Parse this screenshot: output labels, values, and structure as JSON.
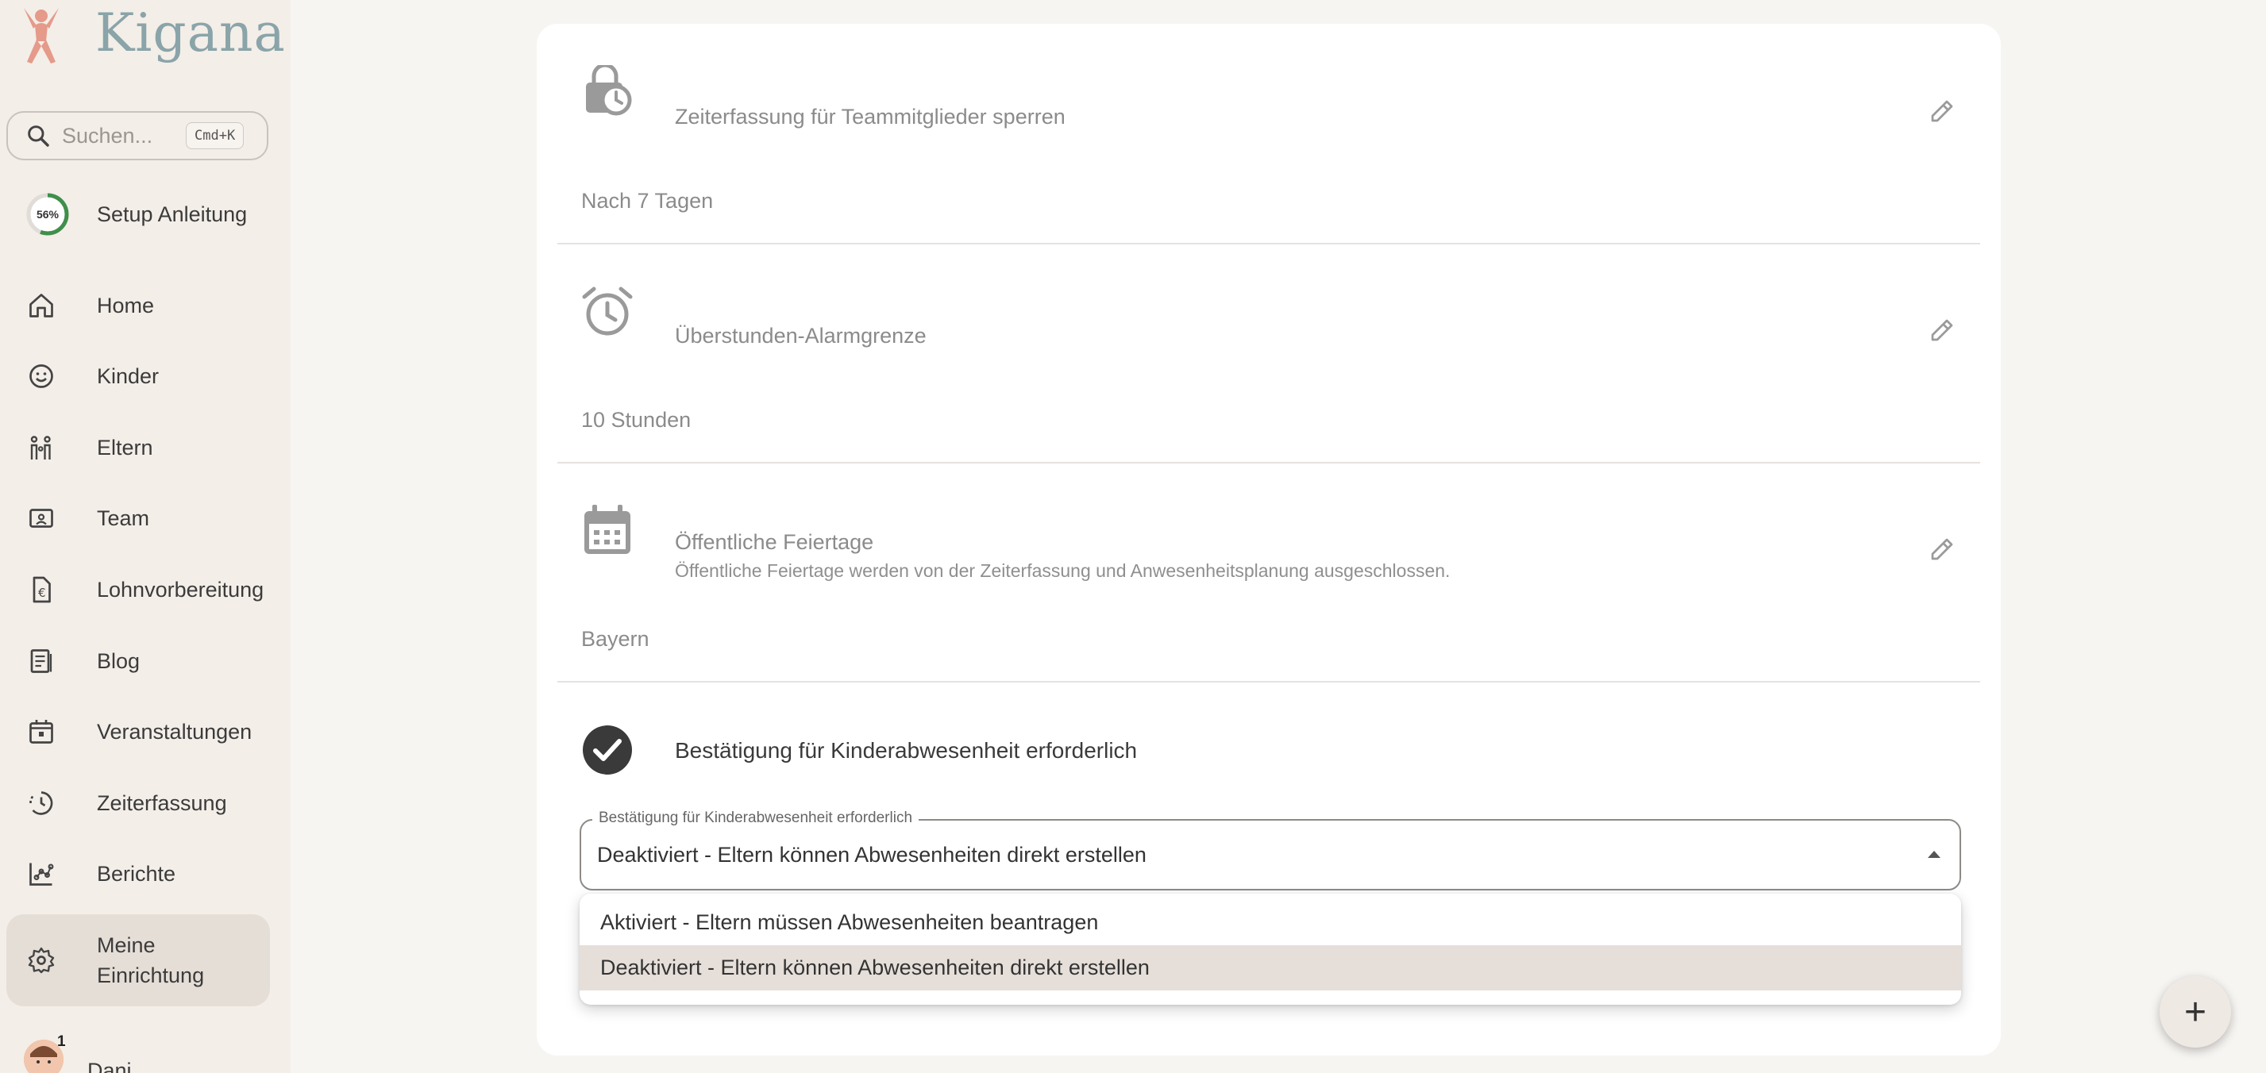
{
  "app": {
    "name": "Kigana"
  },
  "search": {
    "placeholder": "Suchen...",
    "shortcut": "Cmd+K"
  },
  "setup": {
    "label": "Setup Anleitung",
    "progress_text": "56%",
    "progress": 0.56
  },
  "nav": [
    {
      "id": "home",
      "label": "Home",
      "icon": "home-icon"
    },
    {
      "id": "kinder",
      "label": "Kinder",
      "icon": "smiley-icon"
    },
    {
      "id": "eltern",
      "label": "Eltern",
      "icon": "family-icon"
    },
    {
      "id": "team",
      "label": "Team",
      "icon": "badge-icon"
    },
    {
      "id": "lohn",
      "label": "Lohnvorbereitung",
      "icon": "euro-document-icon"
    },
    {
      "id": "blog",
      "label": "Blog",
      "icon": "article-icon"
    },
    {
      "id": "events",
      "label": "Veranstaltungen",
      "icon": "calendar-icon"
    },
    {
      "id": "time",
      "label": "Zeiterfassung",
      "icon": "clock-history-icon"
    },
    {
      "id": "reports",
      "label": "Berichte",
      "icon": "chart-icon"
    },
    {
      "id": "settings",
      "label": "Meine Einrichtung",
      "icon": "gear-icon",
      "active": true
    }
  ],
  "user": {
    "name": "Dani",
    "badge": "1"
  },
  "sections": [
    {
      "id": "lock",
      "title": "Zeiterfassung für Teammitglieder sperren",
      "value": "Nach 7 Tagen",
      "icon": "lock-clock-icon"
    },
    {
      "id": "overtime",
      "title": "Überstunden-Alarmgrenze",
      "value": "10 Stunden",
      "icon": "alarm-clock-icon"
    },
    {
      "id": "holidays",
      "title": "Öffentliche Feiertage",
      "subtitle": "Öffentliche Feiertage werden von der Zeiterfassung und Anwesenheitsplanung ausgeschlossen.",
      "value": "Bayern",
      "icon": "calendar-icon"
    }
  ],
  "confirmation": {
    "title": "Bestätigung für Kinderabwesenheit erforderlich",
    "select_label": "Bestätigung für Kinderabwesenheit erforderlich",
    "selected": "Deaktiviert - Eltern können Abwesenheiten direkt erstellen",
    "options": [
      "Aktiviert - Eltern müssen Abwesenheiten beantragen",
      "Deaktiviert - Eltern können Abwesenheiten direkt erstellen"
    ]
  },
  "fab": {
    "label": "+"
  },
  "colors": {
    "accent": "#8aa4a9",
    "logo_figure": "#e59a8a",
    "progress": "#3f8f4a",
    "active_bg": "#e5ded7"
  }
}
